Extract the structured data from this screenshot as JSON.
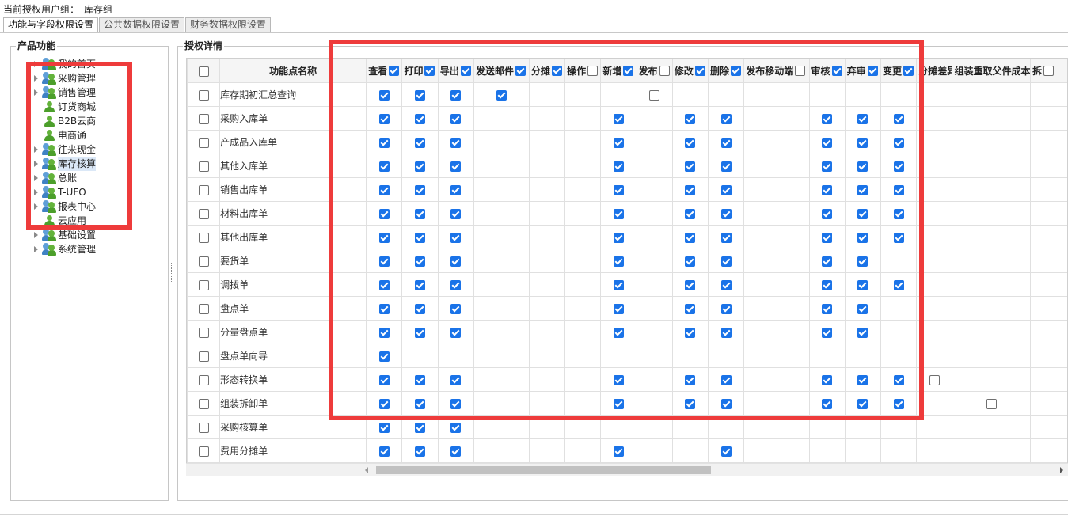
{
  "header": {
    "group_label": "当前授权用户组：",
    "group_value": "库存组"
  },
  "tabs": [
    "功能与字段权限设置",
    "公共数据权限设置",
    "财务数据权限设置"
  ],
  "left": {
    "title": "产品功能",
    "tree": [
      {
        "label": "我的首页",
        "arrow": true,
        "icon": "group-icon"
      },
      {
        "label": "采购管理",
        "arrow": true,
        "icon": "group-icon"
      },
      {
        "label": "销售管理",
        "arrow": true,
        "icon": "group-icon"
      },
      {
        "label": "订货商城",
        "arrow": false,
        "icon": "person-icon"
      },
      {
        "label": "B2B云商",
        "arrow": false,
        "icon": "person-icon"
      },
      {
        "label": "电商通",
        "arrow": false,
        "icon": "person-icon"
      },
      {
        "label": "往来现金",
        "arrow": true,
        "icon": "group-icon"
      },
      {
        "label": "库存核算",
        "arrow": true,
        "icon": "group-icon",
        "selected": true
      },
      {
        "label": "总账",
        "arrow": true,
        "icon": "group-icon"
      },
      {
        "label": "T-UFO",
        "arrow": true,
        "icon": "group-icon"
      },
      {
        "label": "报表中心",
        "arrow": true,
        "icon": "group-icon"
      },
      {
        "label": "云应用",
        "arrow": false,
        "icon": "person-icon"
      },
      {
        "label": "基础设置",
        "arrow": true,
        "icon": "group-icon"
      },
      {
        "label": "系统管理",
        "arrow": true,
        "icon": "group-icon"
      }
    ]
  },
  "right": {
    "title": "授权详情",
    "name_header": "功能点名称",
    "columns": [
      {
        "label": "查看",
        "checked": true
      },
      {
        "label": "打印",
        "checked": true
      },
      {
        "label": "导出",
        "checked": true
      },
      {
        "label": "发送邮件",
        "checked": true
      },
      {
        "label": "分摊",
        "checked": true
      },
      {
        "label": "操作",
        "checked": false
      },
      {
        "label": "新增",
        "checked": true
      },
      {
        "label": "发布",
        "checked": false
      },
      {
        "label": "修改",
        "checked": true
      },
      {
        "label": "删除",
        "checked": true
      },
      {
        "label": "发布移动端",
        "checked": false
      },
      {
        "label": "审核",
        "checked": true
      },
      {
        "label": "弃审",
        "checked": true
      },
      {
        "label": "变更",
        "checked": true
      },
      {
        "label": "分摊差异金额",
        "checked": false
      },
      {
        "label": "组装重取父件成本",
        "checked": false
      },
      {
        "label": "拆",
        "checked": false
      }
    ],
    "rows": [
      {
        "name": "库存期初汇总查询",
        "cells": [
          1,
          1,
          1,
          1,
          null,
          null,
          null,
          0,
          null,
          null,
          null,
          null,
          null,
          null,
          null,
          null,
          null
        ]
      },
      {
        "name": "采购入库单",
        "cells": [
          1,
          1,
          1,
          null,
          null,
          null,
          1,
          null,
          1,
          1,
          null,
          1,
          1,
          1,
          null,
          null,
          null
        ]
      },
      {
        "name": "产成品入库单",
        "cells": [
          1,
          1,
          1,
          null,
          null,
          null,
          1,
          null,
          1,
          1,
          null,
          1,
          1,
          1,
          null,
          null,
          null
        ]
      },
      {
        "name": "其他入库单",
        "cells": [
          1,
          1,
          1,
          null,
          null,
          null,
          1,
          null,
          1,
          1,
          null,
          1,
          1,
          1,
          null,
          null,
          null
        ]
      },
      {
        "name": "销售出库单",
        "cells": [
          1,
          1,
          1,
          null,
          null,
          null,
          1,
          null,
          1,
          1,
          null,
          1,
          1,
          1,
          null,
          null,
          null
        ]
      },
      {
        "name": "材料出库单",
        "cells": [
          1,
          1,
          1,
          null,
          null,
          null,
          1,
          null,
          1,
          1,
          null,
          1,
          1,
          1,
          null,
          null,
          null
        ]
      },
      {
        "name": "其他出库单",
        "cells": [
          1,
          1,
          1,
          null,
          null,
          null,
          1,
          null,
          1,
          1,
          null,
          1,
          1,
          1,
          null,
          null,
          null
        ]
      },
      {
        "name": "要货单",
        "cells": [
          1,
          1,
          1,
          null,
          null,
          null,
          1,
          null,
          1,
          1,
          null,
          1,
          1,
          null,
          null,
          null,
          null
        ]
      },
      {
        "name": "调拨单",
        "cells": [
          1,
          1,
          1,
          null,
          null,
          null,
          1,
          null,
          1,
          1,
          null,
          1,
          1,
          1,
          null,
          null,
          null
        ]
      },
      {
        "name": "盘点单",
        "cells": [
          1,
          1,
          1,
          null,
          null,
          null,
          1,
          null,
          1,
          1,
          null,
          1,
          1,
          null,
          null,
          null,
          null
        ]
      },
      {
        "name": "分量盘点单",
        "cells": [
          1,
          1,
          1,
          null,
          null,
          null,
          1,
          null,
          1,
          1,
          null,
          1,
          1,
          null,
          null,
          null,
          null
        ]
      },
      {
        "name": "盘点单向导",
        "cells": [
          1,
          null,
          null,
          null,
          null,
          null,
          null,
          null,
          null,
          null,
          null,
          null,
          null,
          null,
          null,
          null,
          null
        ]
      },
      {
        "name": "形态转换单",
        "cells": [
          1,
          1,
          1,
          null,
          null,
          null,
          1,
          null,
          1,
          1,
          null,
          1,
          1,
          1,
          0,
          null,
          null
        ]
      },
      {
        "name": "组装拆卸单",
        "cells": [
          1,
          1,
          1,
          null,
          null,
          null,
          1,
          null,
          1,
          1,
          null,
          1,
          1,
          1,
          null,
          0,
          null
        ]
      },
      {
        "name": "采购核算单",
        "cells": [
          1,
          1,
          1,
          null,
          null,
          null,
          null,
          null,
          null,
          null,
          null,
          null,
          null,
          null,
          null,
          null,
          null
        ]
      },
      {
        "name": "费用分摊单",
        "cells": [
          1,
          1,
          1,
          null,
          null,
          null,
          1,
          null,
          null,
          1,
          null,
          null,
          null,
          null,
          null,
          null,
          null
        ]
      }
    ]
  },
  "colors": {
    "highlight_box": "#ee3b3b",
    "checkbox_checked": "#1a73e8"
  }
}
